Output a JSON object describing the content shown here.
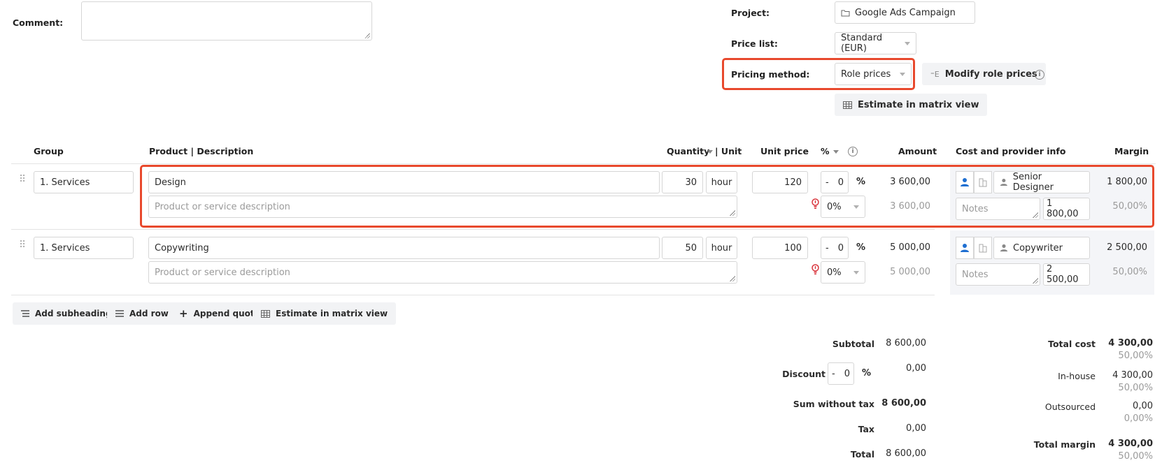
{
  "form": {
    "comment_label": "Comment:",
    "project_label": "Project:",
    "project_value": "Google Ads Campaign",
    "price_list_label": "Price list:",
    "price_list_value": "Standard (EUR)",
    "pricing_method_label": "Pricing method:",
    "pricing_method_value": "Role prices",
    "modify_role_prices_label": "Modify role prices",
    "estimate_matrix_label": "Estimate in matrix view"
  },
  "table": {
    "headers": {
      "group": "Group",
      "product": "Product | Description",
      "quantity": "Quantity",
      "unit": "| Unit",
      "unit_price": "Unit price",
      "percent": "%",
      "amount": "Amount",
      "cost_info": "Cost and provider info",
      "margin": "Margin"
    },
    "rows": [
      {
        "group": "1. Services",
        "product": "Design",
        "description_placeholder": "Product or service description",
        "quantity": "30",
        "unit": "hour",
        "unit_price": "120",
        "discount_sign": "-",
        "discount_value": "0",
        "discount_unit": "%",
        "tax": "0%",
        "amount": "3 600,00",
        "amount_secondary": "3 600,00",
        "provider": "Senior Designer",
        "notes_placeholder": "Notes",
        "cost": "1 800,00",
        "margin": "1 800,00",
        "margin_percent": "50,00%"
      },
      {
        "group": "1. Services",
        "product": "Copywriting",
        "description_placeholder": "Product or service description",
        "quantity": "50",
        "unit": "hour",
        "unit_price": "100",
        "discount_sign": "-",
        "discount_value": "0",
        "discount_unit": "%",
        "tax": "0%",
        "amount": "5 000,00",
        "amount_secondary": "5 000,00",
        "provider": "Copywriter",
        "notes_placeholder": "Notes",
        "cost": "2 500,00",
        "margin": "2 500,00",
        "margin_percent": "50,00%"
      }
    ]
  },
  "actions": {
    "add_subheading": "Add subheading",
    "add_row": "Add row",
    "append_quote": "Append quote",
    "estimate_matrix": "Estimate in matrix view"
  },
  "totals": {
    "subtotal_label": "Subtotal",
    "subtotal_value": "8 600,00",
    "discount_label": "Discount",
    "discount_sign": "-",
    "discount_value": "0",
    "discount_unit": "%",
    "discount_amount": "0,00",
    "sum_without_tax_label": "Sum without tax",
    "sum_without_tax_value": "8 600,00",
    "tax_label": "Tax",
    "tax_value": "0,00",
    "total_label": "Total",
    "total_value": "8 600,00"
  },
  "cost_totals": {
    "total_cost_label": "Total cost",
    "total_cost_value": "4 300,00",
    "total_cost_percent": "50,00%",
    "inhouse_label": "In-house",
    "inhouse_value": "4 300,00",
    "inhouse_percent": "50,00%",
    "outsourced_label": "Outsourced",
    "outsourced_value": "0,00",
    "outsourced_percent": "0,00%",
    "total_margin_label": "Total margin",
    "total_margin_value": "4 300,00",
    "total_margin_percent": "50,00%"
  },
  "colors": {
    "highlight": "#e8492d",
    "person_icon_active": "#1f6fd1",
    "warning_icon": "#d9363e"
  }
}
